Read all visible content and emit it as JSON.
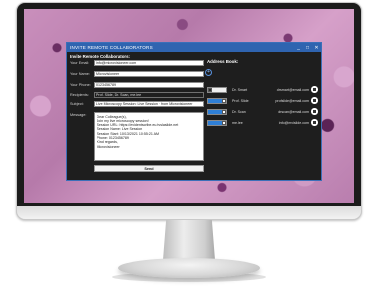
{
  "window": {
    "title": "INVITE REMOTE COLLABORATORS",
    "minimize": "_",
    "maximize": "□",
    "close": "✕"
  },
  "form": {
    "heading": "Invite Remote Collaborators:",
    "email_label": "Your Email:",
    "email_value": "info@microvisioneer.com",
    "name_label": "Your Name:",
    "name_value": "Microvisioneer",
    "phone_label": "Your Phone:",
    "phone_value": "0123456789",
    "recipients_label": "Recipients:",
    "recipients_value": "Prof. Slide, Dr. Scan, me.lee",
    "subject_label": "Subject:",
    "subject_value": "Live Microscopy Session: Live Session · from Microvisioneer",
    "message_label": "Message:",
    "message_lines": [
      "Dear Colleague(s),",
      "Join my live microscopy session!",
      "Session URL: https://evidentscribe.eu.tvslaslide.net",
      "Session Name: Live Session",
      "Session Start: 10/13/2021 10:55:21 AM",
      "Phone: 0123456789",
      "Kind regards,",
      "Microvisioneer"
    ],
    "send_label": "Send",
    "add_label": "+"
  },
  "address_book": {
    "heading": "Address Book:",
    "contacts": [
      {
        "name": "Dr. Smart",
        "email": "drsmart@email.com",
        "enabled": false
      },
      {
        "name": "Prof. Slide",
        "email": "profslide@email.com",
        "enabled": true
      },
      {
        "name": "Dr. Scan",
        "email": "drscan@email.com",
        "enabled": true
      },
      {
        "name": "me.lee",
        "email": "info@mvislide.com",
        "enabled": true
      }
    ]
  },
  "colors": {
    "titlebar": "#2f64b0",
    "toggle_on": "#2f7fd6",
    "dialog_bg": "#1e1e1e"
  }
}
